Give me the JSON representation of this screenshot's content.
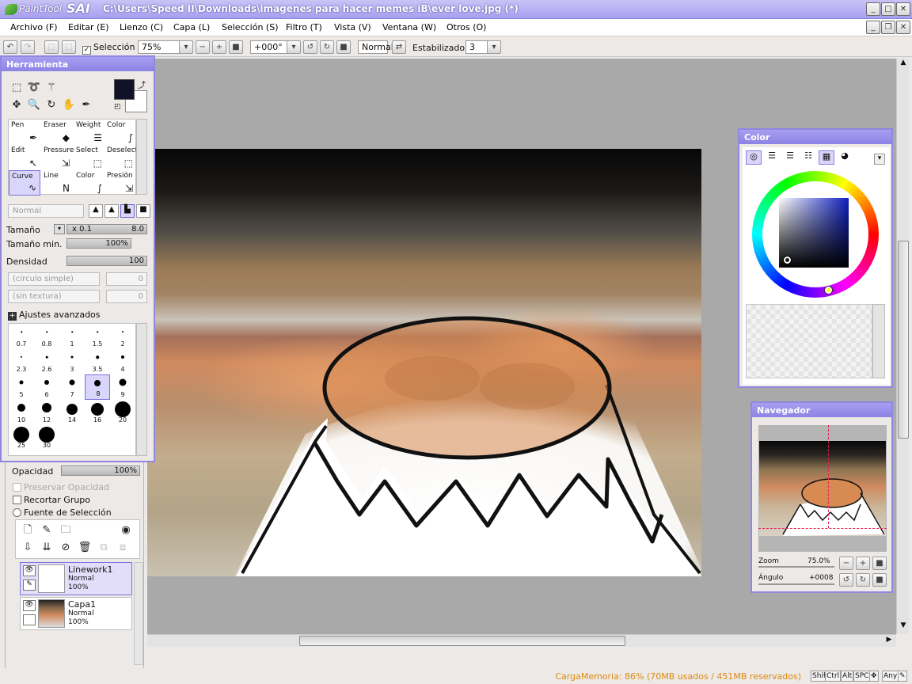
{
  "app": {
    "logo_text": "PaintTool",
    "logo_sai": "SAI",
    "window_title": "C:\\Users\\Speed II\\Downloads\\imagenes para hacer memes iB\\ever love.jpg (*)"
  },
  "menu": [
    "Archivo (F)",
    "Editar (E)",
    "Lienzo (C)",
    "Capa (L)",
    "Selección (S)",
    "Filtro (T)",
    "Vista (V)",
    "Ventana (W)",
    "Otros (O)"
  ],
  "toolbar": {
    "selection_label": "Selección",
    "zoom_value": "75%",
    "angle_value": "+000°",
    "blend_mode": "Normal",
    "stabilizer_label": "Estabilizador",
    "stabilizer_value": "3"
  },
  "tool_panel": {
    "title": "Herramienta",
    "brushes": [
      {
        "label": "Pen",
        "icon": "pen-icon"
      },
      {
        "label": "Eraser",
        "icon": "eraser-icon"
      },
      {
        "label": "Weight",
        "icon": "weight-icon"
      },
      {
        "label": "Color",
        "icon": "color-curve-icon"
      },
      {
        "label": "Edit",
        "icon": "edit-icon"
      },
      {
        "label": "Pressure",
        "icon": "pressure-icon"
      },
      {
        "label": "Select",
        "icon": "select-icon"
      },
      {
        "label": "Deselect",
        "icon": "deselect-icon"
      },
      {
        "label": "Curve",
        "icon": "curve-icon"
      },
      {
        "label": "Line",
        "icon": "line-icon"
      },
      {
        "label": "Color",
        "icon": "color-line-icon"
      },
      {
        "label": "Presión",
        "icon": "presion-icon"
      }
    ],
    "mode_placeholder": "Normal",
    "size_label": "Tamaño",
    "size_multiplier": "x 0.1",
    "size_value": "8.0",
    "min_size_label": "Tamaño min.",
    "min_size_value": "100%",
    "density_label": "Densidad",
    "density_value": "100",
    "shape_dropdown": "(círculo simple)",
    "shape_value": "0",
    "texture_dropdown": "(sin textura)",
    "texture_value": "0",
    "advanced_label": "Ajustes avanzados",
    "brush_sizes": [
      "0.7",
      "0.8",
      "1",
      "1.5",
      "2",
      "2.3",
      "2.6",
      "3",
      "3.5",
      "4",
      "5",
      "6",
      "7",
      "8",
      "9",
      "10",
      "12",
      "14",
      "16",
      "20",
      "25",
      "30"
    ],
    "selected_brush_size": "8"
  },
  "layers_panel": {
    "opacity_label": "Opacidad",
    "opacity_value": "100%",
    "preserve_opacity": "Preservar Opacidad",
    "clip_group": "Recortar Grupo",
    "selection_source": "Fuente de Selección",
    "layers": [
      {
        "name": "Linework1",
        "mode": "Normal",
        "opacity": "100%",
        "selected": true
      },
      {
        "name": "Capa1",
        "mode": "Normal",
        "opacity": "100%",
        "selected": false
      }
    ]
  },
  "color_panel": {
    "title": "Color",
    "primary_color": "#11112a",
    "secondary_color": "#ffffff",
    "sv_hue_color": "#0f1fbf"
  },
  "navigator_panel": {
    "title": "Navegador",
    "zoom_label": "Zoom",
    "zoom_value": "75.0%",
    "angle_label": "Ángulo",
    "angle_value": "+0008"
  },
  "status": {
    "memory": "CargaMemoria: 86% (70MB usados / 451MB reservados)",
    "keys": [
      "Shift",
      "Ctrl",
      "Alt",
      "SPC",
      "Any"
    ]
  }
}
